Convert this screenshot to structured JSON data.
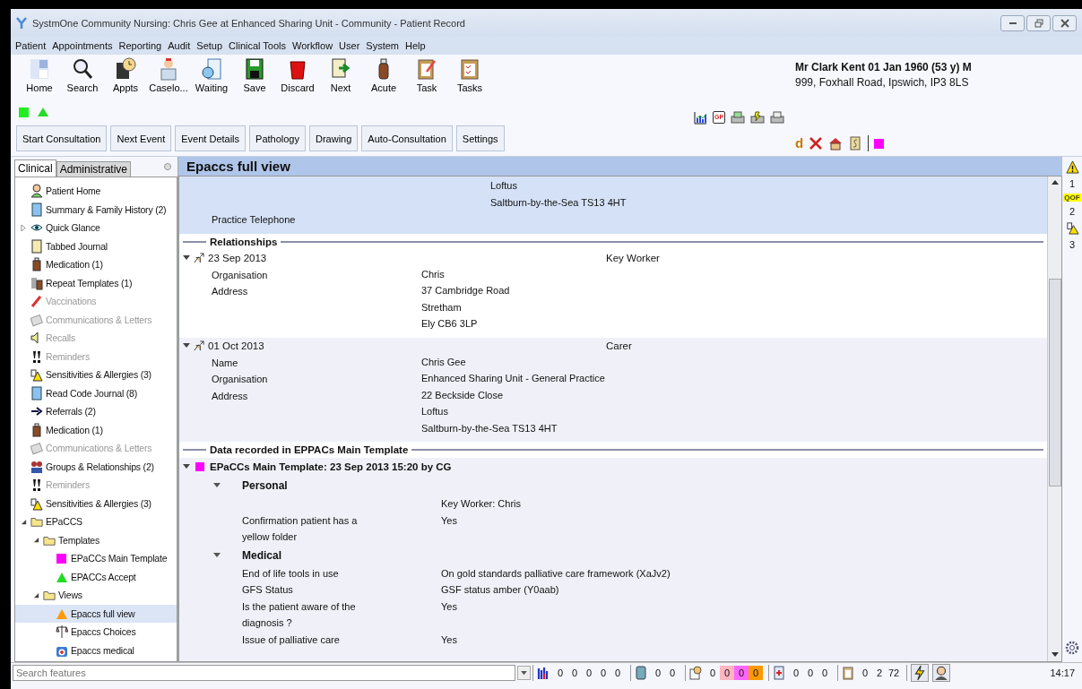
{
  "window": {
    "title": "SystmOne Community Nursing: Chris Gee at Enhanced Sharing Unit - Community - Patient Record"
  },
  "menu": [
    "Patient",
    "Appointments",
    "Reporting",
    "Audit",
    "Setup",
    "Clinical Tools",
    "Workflow",
    "User",
    "System",
    "Help"
  ],
  "toolbar": [
    {
      "label": "Home"
    },
    {
      "label": "Search"
    },
    {
      "label": "Appts"
    },
    {
      "label": "Caselo..."
    },
    {
      "label": "Waiting"
    },
    {
      "label": "Save"
    },
    {
      "label": "Discard"
    },
    {
      "label": "Next"
    },
    {
      "label": "Acute"
    },
    {
      "label": "Task"
    },
    {
      "label": "Tasks"
    }
  ],
  "indicators": [
    {
      "kind": "square",
      "color": "#22ee22"
    },
    {
      "kind": "triangle",
      "color": "#22dd22"
    }
  ],
  "action_buttons": [
    "Start Consultation",
    "Next Event",
    "Event Details",
    "Pathology",
    "Drawing",
    "Auto-Consultation",
    "Settings"
  ],
  "patient": {
    "name": "Mr Clark Kent 01 Jan 1960 (53 y) M",
    "address": "999, Foxhall Road, Ipswich, IP3 8LS"
  },
  "report_tools": {
    "gp_badge": "GP"
  },
  "quick_tools": {
    "glyph": "d"
  },
  "sidebar": {
    "tabs": [
      {
        "label": "Clinical",
        "selected": true
      },
      {
        "label": "Administrative",
        "selected": false
      }
    ],
    "items": [
      {
        "label": "Patient Home",
        "disabled": false,
        "selected": false
      },
      {
        "label": "Summary & Family History (2)",
        "disabled": false,
        "selected": false
      },
      {
        "label": "Quick Glance",
        "disabled": false,
        "selected": false,
        "expanded": false
      },
      {
        "label": "Tabbed Journal",
        "disabled": false,
        "selected": false
      },
      {
        "label": "Medication (1)",
        "disabled": false,
        "selected": false
      },
      {
        "label": "Repeat Templates (1)",
        "disabled": false,
        "selected": false
      },
      {
        "label": "Vaccinations",
        "disabled": true,
        "selected": false
      },
      {
        "label": "Communications & Letters",
        "disabled": true,
        "selected": false
      },
      {
        "label": "Recalls",
        "disabled": true,
        "selected": false
      },
      {
        "label": "Reminders",
        "disabled": true,
        "selected": false
      },
      {
        "label": "Sensitivities & Allergies (3)",
        "disabled": false,
        "selected": false
      },
      {
        "label": "Read Code Journal (8)",
        "disabled": false,
        "selected": false
      },
      {
        "label": "Referrals (2)",
        "disabled": false,
        "selected": false
      },
      {
        "label": "Medication (1)",
        "disabled": false,
        "selected": false
      },
      {
        "label": "Communications & Letters",
        "disabled": true,
        "selected": false
      },
      {
        "label": "Groups & Relationships (2)",
        "disabled": false,
        "selected": false
      },
      {
        "label": "Reminders",
        "disabled": true,
        "selected": false
      },
      {
        "label": "Sensitivities & Allergies (3)",
        "disabled": false,
        "selected": false
      },
      {
        "label": "EPaCCS",
        "disabled": false,
        "selected": false,
        "expanded": true,
        "children": [
          {
            "label": "Templates",
            "disabled": false,
            "selected": false,
            "expanded": true,
            "children": [
              {
                "label": "EPaCCs Main Template",
                "disabled": false,
                "selected": false,
                "color": "#ff00ff"
              },
              {
                "label": "EPACCs Accept",
                "disabled": false,
                "selected": false,
                "color": "#22dd22"
              }
            ]
          },
          {
            "label": "Views",
            "disabled": false,
            "selected": false,
            "expanded": true,
            "children": [
              {
                "label": "Epaccs full view",
                "disabled": false,
                "selected": true,
                "color": "#ff9900"
              },
              {
                "label": "Epaccs Choices",
                "disabled": false,
                "selected": false
              },
              {
                "label": "Epaccs medical",
                "disabled": false,
                "selected": false
              }
            ]
          }
        ]
      }
    ]
  },
  "content": {
    "title": "Epaccs full view",
    "practice_rows": [
      {
        "value": "Loftus"
      },
      {
        "value": "Saltburn-by-the-Sea TS13 4HT"
      },
      {
        "label": "Practice Telephone"
      }
    ],
    "relationships": {
      "heading": "Relationships",
      "entries": [
        {
          "date": "23 Sep 2013",
          "role": "Key Worker",
          "rows": [
            {
              "label": "Organisation",
              "value": "Chris"
            },
            {
              "label": "Address",
              "value": "37 Cambridge Road"
            },
            {
              "value": "Stretham"
            },
            {
              "value": "Ely CB6 3LP"
            }
          ]
        },
        {
          "date": "01 Oct 2013",
          "role": "Carer",
          "rows": [
            {
              "label": "Name",
              "value": "Chris Gee"
            },
            {
              "label": "Organisation",
              "value": "Enhanced Sharing Unit - General Practice"
            },
            {
              "label": "Address",
              "value": "22 Beckside Close"
            },
            {
              "value": "Loftus"
            },
            {
              "value": "Saltburn-by-the-Sea TS13 4HT"
            }
          ]
        }
      ]
    },
    "template_data": {
      "heading": "Data recorded in EPPACs Main Template",
      "template": {
        "title": "EPaCCs Main Template: 23 Sep 2013 15:20 by CG",
        "color": "#ff00ff",
        "expanded": true
      },
      "groups": [
        {
          "heading": "Personal",
          "expanded": true,
          "rows": [
            {
              "value": "Key Worker:   Chris"
            },
            {
              "label": "Confirmation patient has a yellow folder",
              "value": "Yes"
            }
          ]
        },
        {
          "heading": "Medical",
          "expanded": true,
          "rows": [
            {
              "label": "End of life tools in use",
              "value": "On gold standards palliative care framework (XaJv2)"
            },
            {
              "label": "GFS Status",
              "value": "GSF status amber (Y0aab)"
            },
            {
              "label": "Is the patient aware of the diagnosis ?",
              "value": "Yes"
            },
            {
              "label": "Issue of palliative care",
              "value": "Yes"
            }
          ]
        }
      ]
    }
  },
  "alerts_rail": [
    {
      "count": "1"
    },
    {
      "badge": "QOF",
      "count": "2"
    },
    {
      "count": "3"
    }
  ],
  "status_bar": {
    "search": {
      "placeholder": "Search features"
    },
    "counter_groups": [
      {
        "values": [
          {
            "text": "0"
          },
          {
            "text": "0"
          },
          {
            "text": "0"
          },
          {
            "text": "0"
          },
          {
            "text": "0"
          }
        ]
      },
      {
        "values": [
          {
            "text": "0"
          },
          {
            "text": "0"
          }
        ]
      },
      {
        "values": [
          {
            "text": "0"
          },
          {
            "text": "0",
            "color": "#ffb6c1"
          },
          {
            "text": "0",
            "color": "#ff66ff"
          },
          {
            "text": "0",
            "color": "#ff9900"
          }
        ]
      },
      {
        "values": [
          {
            "text": "0"
          },
          {
            "text": "0"
          },
          {
            "text": "0"
          }
        ]
      },
      {
        "values": [
          {
            "text": "0"
          },
          {
            "text": "2"
          },
          {
            "text": "72"
          }
        ]
      }
    ],
    "clock": "14:17"
  }
}
